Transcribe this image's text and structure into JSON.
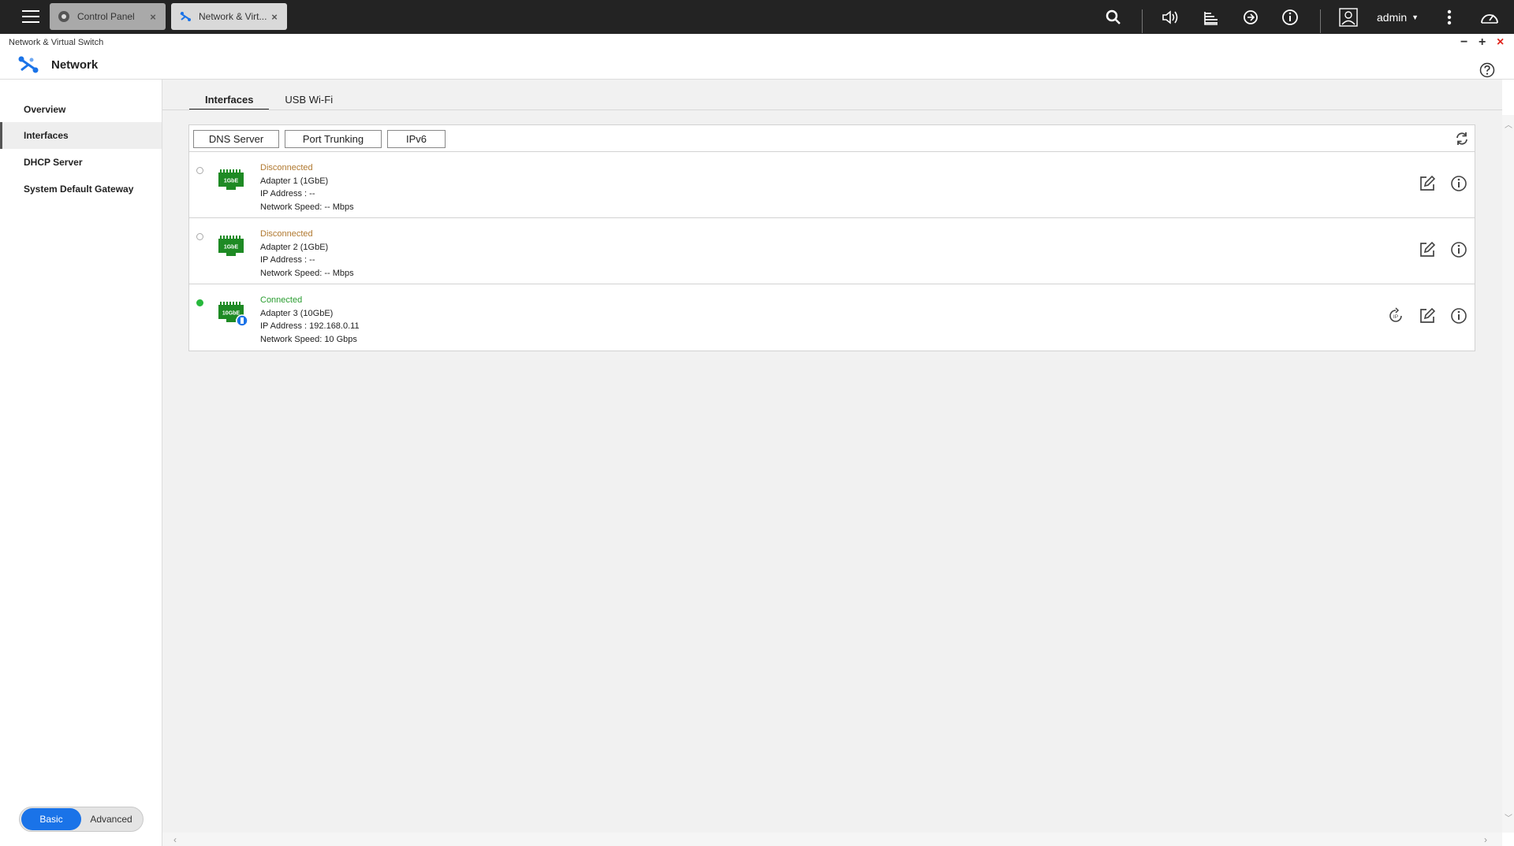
{
  "taskbar": {
    "tabs": [
      {
        "label": "Control Panel",
        "close": "×"
      },
      {
        "label": "Network & Virt...",
        "close": "×"
      }
    ],
    "user": "admin"
  },
  "window": {
    "small_title": "Network & Virtual Switch",
    "title": "Network",
    "controls": {
      "minimize": "−",
      "maximize": "+",
      "close": "×"
    }
  },
  "sidebar": {
    "items": [
      {
        "label": "Overview"
      },
      {
        "label": "Interfaces"
      },
      {
        "label": "DHCP Server"
      },
      {
        "label": "System Default Gateway"
      }
    ],
    "mode": {
      "basic": "Basic",
      "advanced": "Advanced"
    }
  },
  "main": {
    "tabs": [
      {
        "label": "Interfaces"
      },
      {
        "label": "USB Wi-Fi"
      }
    ],
    "toolbar": {
      "dns": "DNS Server",
      "trunking": "Port Trunking",
      "ipv6": "IPv6"
    },
    "adapters": [
      {
        "status": "Disconnected",
        "name": "Adapter 1 (1GbE)",
        "ip": "IP Address : --",
        "speed": "Network Speed: -- Mbps",
        "badge": "1GbE"
      },
      {
        "status": "Disconnected",
        "name": "Adapter 2 (1GbE)",
        "ip": "IP Address : --",
        "speed": "Network Speed: -- Mbps",
        "badge": "1GbE"
      },
      {
        "status": "Connected",
        "name": "Adapter 3 (10GbE)",
        "ip": "IP Address : 192.168.0.11",
        "speed": "Network Speed: 10 Gbps",
        "badge": "10GbE"
      }
    ]
  },
  "colors": {
    "accent": "#1a73e8",
    "connected": "#2a9d30",
    "disconnected": "#b0782f",
    "nic_green": "#1e8a24",
    "close": "#e0241b"
  }
}
